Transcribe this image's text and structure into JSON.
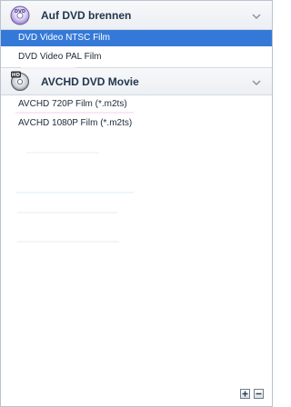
{
  "groups": [
    {
      "title": "Auf DVD brennen",
      "icon": "dvd-disc-icon",
      "items": [
        {
          "label": "DVD Video NTSC Film",
          "selected": true
        },
        {
          "label": "DVD Video PAL Film",
          "selected": false
        }
      ]
    },
    {
      "title": "AVCHD DVD Movie",
      "icon": "hd-dvd-disc-icon",
      "items": [
        {
          "label": "AVCHD 720P Film (*.m2ts)",
          "selected": false
        },
        {
          "label": "AVCHD 1080P Film (*.m2ts)",
          "selected": false
        }
      ]
    }
  ],
  "footer": {
    "add_icon": "add-icon",
    "remove_icon": "remove-icon"
  },
  "colors": {
    "selection": "#3579d8",
    "header_text": "#22364d",
    "border": "#b9c3cf"
  }
}
